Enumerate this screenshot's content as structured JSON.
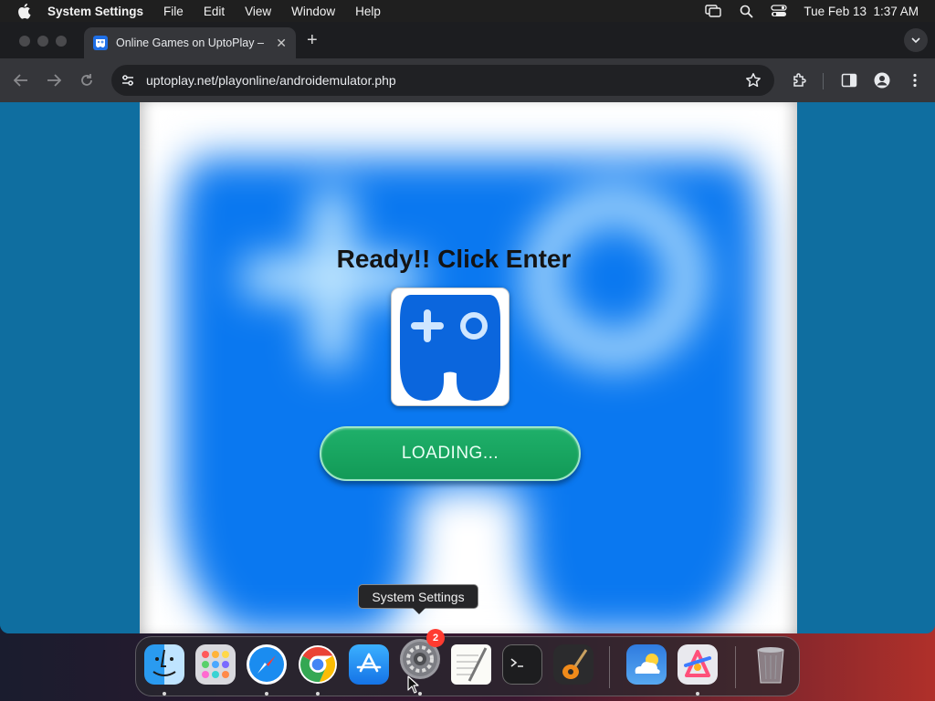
{
  "menubar": {
    "app_name": "System Settings",
    "items": [
      "File",
      "Edit",
      "View",
      "Window",
      "Help"
    ],
    "datetime": "Tue Feb 13  1:37 AM"
  },
  "browser": {
    "tab_title": "Online Games on UptoPlay –",
    "url": "uptoplay.net/playonline/androidemulator.php"
  },
  "page": {
    "heading": "Ready!! Click Enter",
    "loading_label": "LOADING..."
  },
  "tooltip": {
    "text": "System Settings"
  },
  "dock": {
    "badge_count": "2",
    "apps": [
      "Finder",
      "Launchpad",
      "Safari",
      "Google Chrome",
      "App Store",
      "System Settings",
      "TextEdit",
      "Terminal",
      "GarageBand",
      "Weather",
      "Pixelmator",
      "Trash"
    ]
  },
  "colors": {
    "page_background": "#0f6ea0",
    "brand_blue": "#1f6fe6",
    "loading_green": "#129a57"
  }
}
